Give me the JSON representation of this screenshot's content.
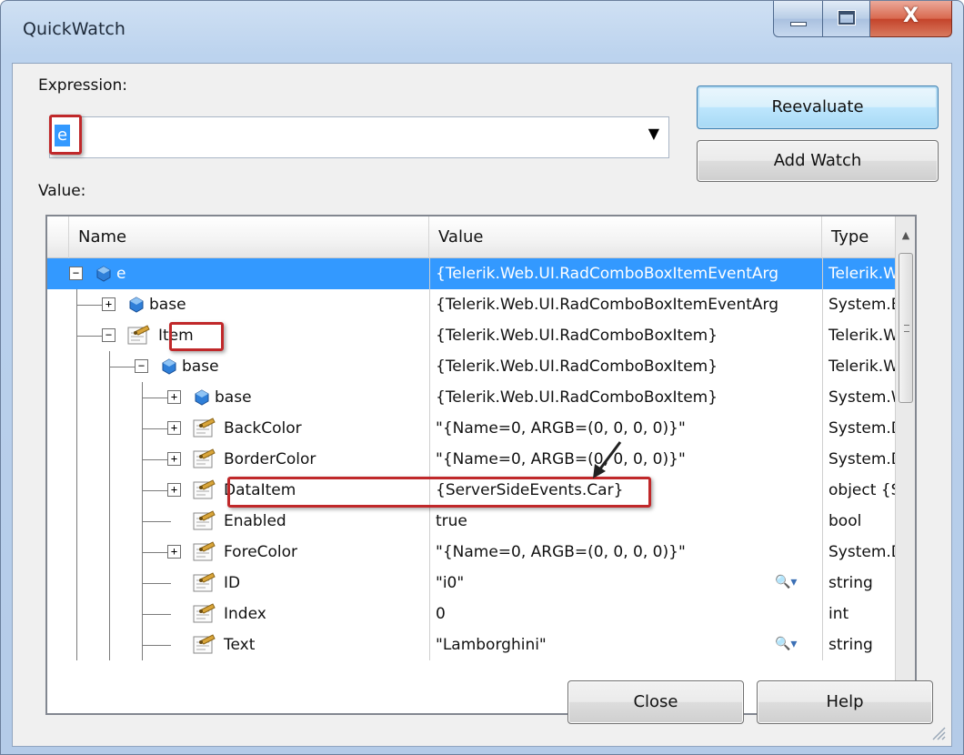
{
  "window": {
    "title": "QuickWatch",
    "controls": {
      "minimize": "minimize",
      "maximize": "maximize",
      "close_glyph": "X"
    }
  },
  "expression": {
    "label": "Expression:",
    "value": "e"
  },
  "buttons": {
    "reevaluate": "Reevaluate",
    "add_watch": "Add Watch",
    "close": "Close",
    "help": "Help"
  },
  "value_label": "Value:",
  "grid": {
    "columns": [
      "Name",
      "Value",
      "Type"
    ],
    "rows": [
      {
        "name": "e",
        "value": "{Telerik.Web.UI.RadComboBoxItemEventArg",
        "type": "Telerik.W",
        "icon": "field-icon",
        "expander": "−",
        "selected": true
      },
      {
        "name": "base",
        "value": "{Telerik.Web.UI.RadComboBoxItemEventArg",
        "type": "System.E",
        "icon": "field-icon",
        "expander": "+"
      },
      {
        "name": "Item",
        "value": "{Telerik.Web.UI.RadComboBoxItem}",
        "type": "Telerik.W",
        "icon": "property-icon",
        "expander": "−"
      },
      {
        "name": "base",
        "value": "{Telerik.Web.UI.RadComboBoxItem}",
        "type": "Telerik.W",
        "icon": "field-icon",
        "expander": "−"
      },
      {
        "name": "base",
        "value": "{Telerik.Web.UI.RadComboBoxItem}",
        "type": "System.W",
        "icon": "field-icon",
        "expander": "+"
      },
      {
        "name": "BackColor",
        "value": "\"{Name=0, ARGB=(0, 0, 0, 0)}\"",
        "type": "System.D",
        "icon": "property-icon",
        "expander": "+"
      },
      {
        "name": "BorderColor",
        "value": "\"{Name=0, ARGB=(0, 0, 0, 0)}\"",
        "type": "System.D",
        "icon": "property-icon",
        "expander": "+"
      },
      {
        "name": "DataItem",
        "value": "{ServerSideEvents.Car}",
        "type": "object {S",
        "icon": "property-icon",
        "expander": "+"
      },
      {
        "name": "Enabled",
        "value": "true",
        "type": "bool",
        "icon": "property-icon",
        "expander": ""
      },
      {
        "name": "ForeColor",
        "value": "\"{Name=0, ARGB=(0, 0, 0, 0)}\"",
        "type": "System.D",
        "icon": "property-icon",
        "expander": "+"
      },
      {
        "name": "ID",
        "value": "\"i0\"",
        "type": "string",
        "icon": "property-icon",
        "expander": "",
        "visualizer": true
      },
      {
        "name": "Index",
        "value": "0",
        "type": "int",
        "icon": "property-icon",
        "expander": ""
      },
      {
        "name": "Text",
        "value": "\"Lamborghini\"",
        "type": "string",
        "icon": "property-icon",
        "expander": "",
        "visualizer": true
      }
    ]
  },
  "colors": {
    "selection": "#3399ff",
    "annotation_red": "#c0282a"
  }
}
